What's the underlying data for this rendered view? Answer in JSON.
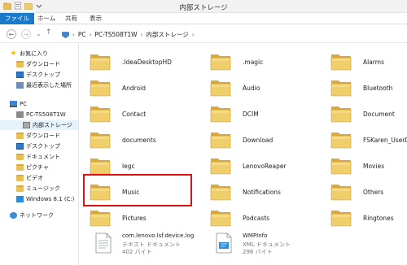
{
  "window": {
    "title": "内部ストレージ"
  },
  "ribbon": {
    "tabs": [
      "ファイル",
      "ホーム",
      "共有",
      "表示"
    ]
  },
  "address": {
    "crumbs": [
      "PC",
      "PC-TS508T1W",
      "内部ストレージ"
    ]
  },
  "nav": {
    "favorites_label": "お気に入り",
    "favorites": [
      "ダウンロード",
      "デスクトップ",
      "最近表示した場所"
    ],
    "pc_label": "PC",
    "pc_children": [
      "PC-TS508T1W",
      "内部ストレージ",
      "ダウンロード",
      "デスクトップ",
      "ドキュメント",
      "ピクチャ",
      "ビデオ",
      "ミュージック",
      "Windows 8.1 (C:)"
    ],
    "network_label": "ネットワーク"
  },
  "folders": [
    ".IdeaDesktopHD",
    ".magic",
    "Alarms",
    "Android",
    "Audio",
    "Bluetooth",
    "Contact",
    "DCIM",
    "Document",
    "documents",
    "Download",
    "FSKaren_UserDic",
    "legc",
    "LenovoReaper",
    "Movies",
    "Music",
    "Notifications",
    "Others",
    "Pictures",
    "Podcasts",
    "Ringtones"
  ],
  "files": [
    {
      "name": "com.lenovo.lsf.device.log",
      "type": "テキスト ドキュメント",
      "size": "402 バイト"
    },
    {
      "name": "WMPInfo",
      "type": "XML ドキュメント",
      "size": "296 バイト"
    }
  ],
  "colors": {
    "accent": "#1979ca",
    "highlight": "#e01010",
    "folder": "#e8c058",
    "selection": "#e5f3fb"
  }
}
